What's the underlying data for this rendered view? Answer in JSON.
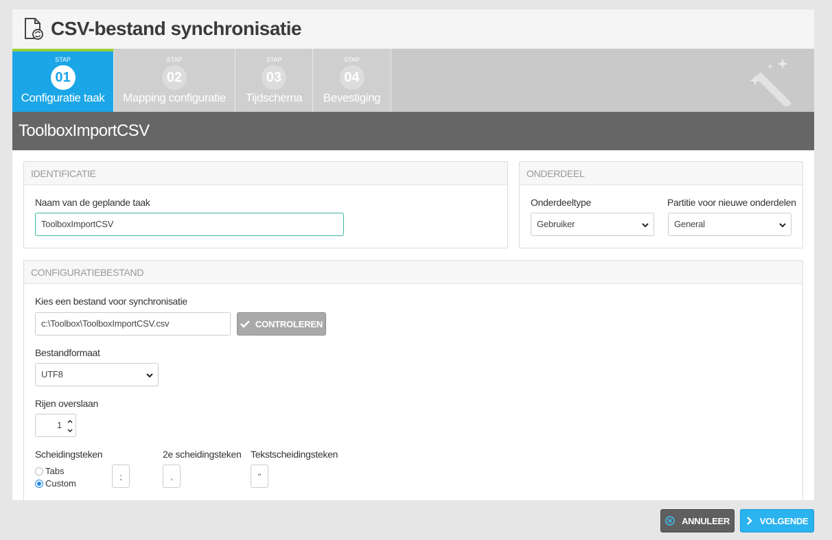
{
  "window": {
    "title": "CSV-bestand synchronisatie"
  },
  "steps": [
    {
      "stap": "STAP",
      "number": "01",
      "label": "Configuratie taak",
      "active": true
    },
    {
      "stap": "STAP",
      "number": "02",
      "label": "Mapping configuratie",
      "active": false
    },
    {
      "stap": "STAP",
      "number": "03",
      "label": "Tijdschema",
      "active": false
    },
    {
      "stap": "STAP",
      "number": "04",
      "label": "Bevestiging",
      "active": false
    }
  ],
  "task_name_header": "ToolboxImportCSV",
  "identificatie": {
    "heading": "IDENTIFICATIE",
    "name_label": "Naam van de geplande taak",
    "name_value": "ToolboxImportCSV"
  },
  "onderdeel": {
    "heading": "ONDERDEEL",
    "type_label": "Onderdeeltype",
    "type_value": "Gebruiker",
    "partition_label": "Partitie voor nieuwe onderdelen",
    "partition_value": "General"
  },
  "config": {
    "heading": "CONFIGURATIEBESTAND",
    "file_label": "Kies een bestand voor synchronisatie",
    "file_value": "c:\\Toolbox\\ToolboxImportCSV.csv",
    "check_button": "CONTROLEREN",
    "format_label": "Bestandformaat",
    "format_value": "UTF8",
    "skip_label": "Rijen overslaan",
    "skip_value": "1",
    "sep_label": "Scheidingsteken",
    "sep_option_tabs": "Tabs",
    "sep_option_custom": "Custom",
    "sep_value": ";",
    "sep2_label": "2e scheidingsteken",
    "sep2_value": ",",
    "text_sep_label": "Tekstscheidingsteken",
    "text_sep_value": "\""
  },
  "footer": {
    "cancel_label": "ANNULEER",
    "next_label": "VOLGENDE"
  },
  "colors": {
    "active_step": "#1ba6e8",
    "step_accent": "#9bcf3a",
    "next_button": "#2bb3f0",
    "cancel_button": "#5f5f5f"
  }
}
